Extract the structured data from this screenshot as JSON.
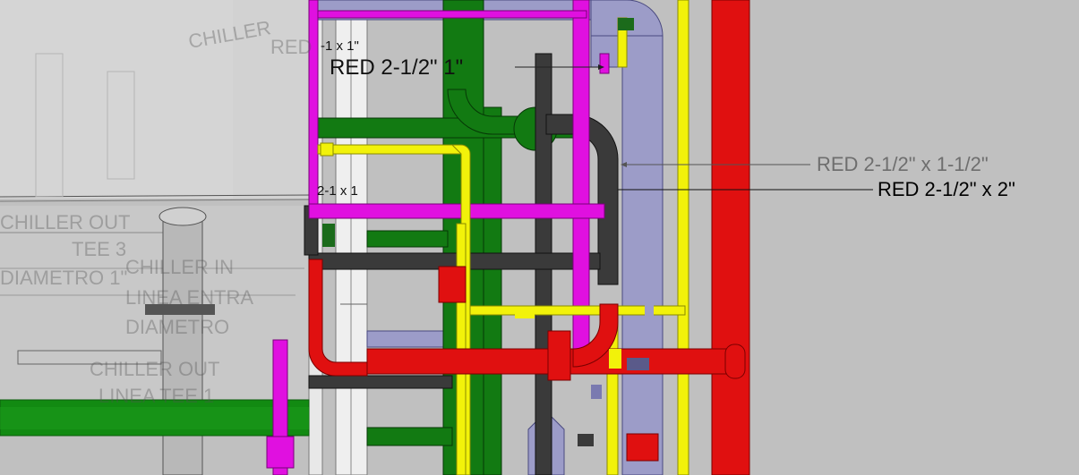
{
  "viewport": {
    "name": "3d-piping-model-view",
    "background_color": "#c0c0c0"
  },
  "colors": {
    "red_pipe": "#e01010",
    "magenta_pipe": "#e010e0",
    "yellow_pipe": "#f2f20a",
    "green_pipe": "#127a12",
    "dark_gray_pipe": "#3a3a3a",
    "lavender_pipe": "#9c9cc8",
    "structure_white": "#efefef",
    "ghost_equipment": "#dcdcdc"
  },
  "annotations": {
    "reducer_top_partial": "-1     x 1\"",
    "reducer_top_main": "RED 2-1/2\"   1\"",
    "reducer_1_1_2": "RED 2-1/2\" x 1-1/2\"",
    "reducer_2": "RED 2-1/2\" x 2\"",
    "reducer_mid_partial": "2-1     x 1"
  },
  "ghost_labels": {
    "chiller_out_1": "CHILLER OUT",
    "tee_1": "TEE 3",
    "diametro_1": "DIAMETRO 1\"",
    "chiller_in": "CHILLER IN",
    "linea_entrada": "LINEA ENTRA",
    "diametro_2": "DIAMETRO",
    "chiller_out_2": "CHILLER OUT",
    "linea_tee": "LINEA    TEE 1",
    "top_ghost": "CHILLER",
    "top_ghost_2": "RED"
  }
}
